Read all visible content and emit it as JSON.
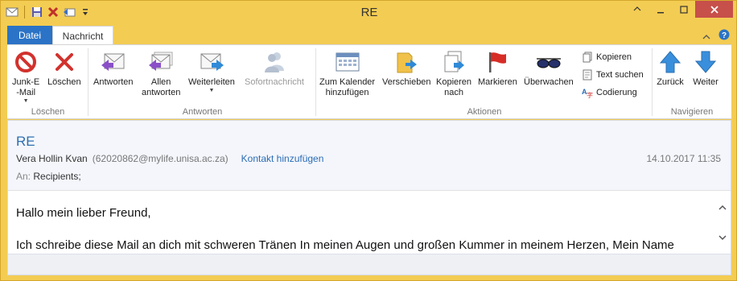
{
  "window": {
    "title": "RE"
  },
  "tabs": {
    "file": "Datei",
    "message": "Nachricht"
  },
  "ribbon": {
    "loeschen": {
      "label": "Löschen",
      "junk_line1": "Junk-E",
      "junk_line2": "-Mail",
      "delete": "Löschen"
    },
    "antworten": {
      "label": "Antworten",
      "reply": "Antworten",
      "reply_all_line1": "Allen",
      "reply_all_line2": "antworten",
      "forward": "Weiterleiten",
      "im": "Sofortnachricht"
    },
    "aktionen": {
      "label": "Aktionen",
      "calendar_line1": "Zum Kalender",
      "calendar_line2": "hinzufügen",
      "move": "Verschieben",
      "copy_line1": "Kopieren",
      "copy_line2": "nach",
      "flag": "Markieren",
      "watch": "Überwachen",
      "copy_small": "Kopieren",
      "find_text": "Text suchen",
      "encoding": "Codierung"
    },
    "navigieren": {
      "label": "Navigieren",
      "back": "Zurück",
      "next": "Weiter"
    }
  },
  "message": {
    "subject": "RE",
    "sender_name": "Vera Hollin Kvan",
    "sender_address": "(62020862@mylife.unisa.ac.za)",
    "add_contact": "Kontakt hinzufügen",
    "date": "14.10.2017 11:35",
    "to_label": "An:",
    "to_value": "Recipients;",
    "body_line1": "Hallo mein lieber Freund,",
    "body_line2": "Ich schreibe diese Mail an dich mit schweren Tränen In meinen Augen und großen Kummer in meinem Herzen, Mein Name"
  },
  "colors": {
    "accent": "#2b73c6",
    "frame": "#f3cc53",
    "link": "#2b6cb5",
    "close": "#c7504a"
  }
}
